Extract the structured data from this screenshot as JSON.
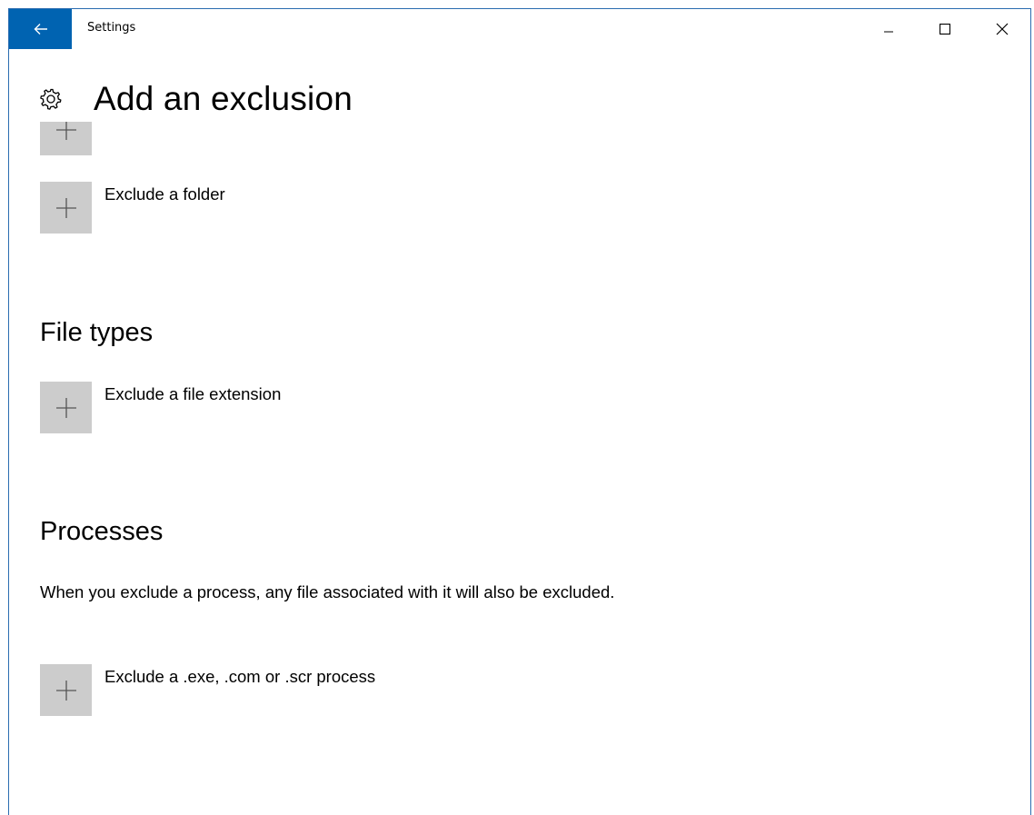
{
  "window": {
    "title": "Settings",
    "accent_color": "#0063b1"
  },
  "header": {
    "title": "Add an exclusion",
    "icon": "gear-icon"
  },
  "items": {
    "exclude_file_partial": {
      "label": ""
    },
    "exclude_folder": {
      "label": "Exclude a folder",
      "icon": "plus-icon"
    },
    "file_types_heading": "File types",
    "exclude_extension": {
      "label": "Exclude a file extension",
      "icon": "plus-icon"
    },
    "processes_heading": "Processes",
    "processes_description": "When you exclude a process, any file associated with it will also be excluded.",
    "exclude_process": {
      "label": "Exclude a .exe, .com or .scr process",
      "icon": "plus-icon"
    }
  }
}
